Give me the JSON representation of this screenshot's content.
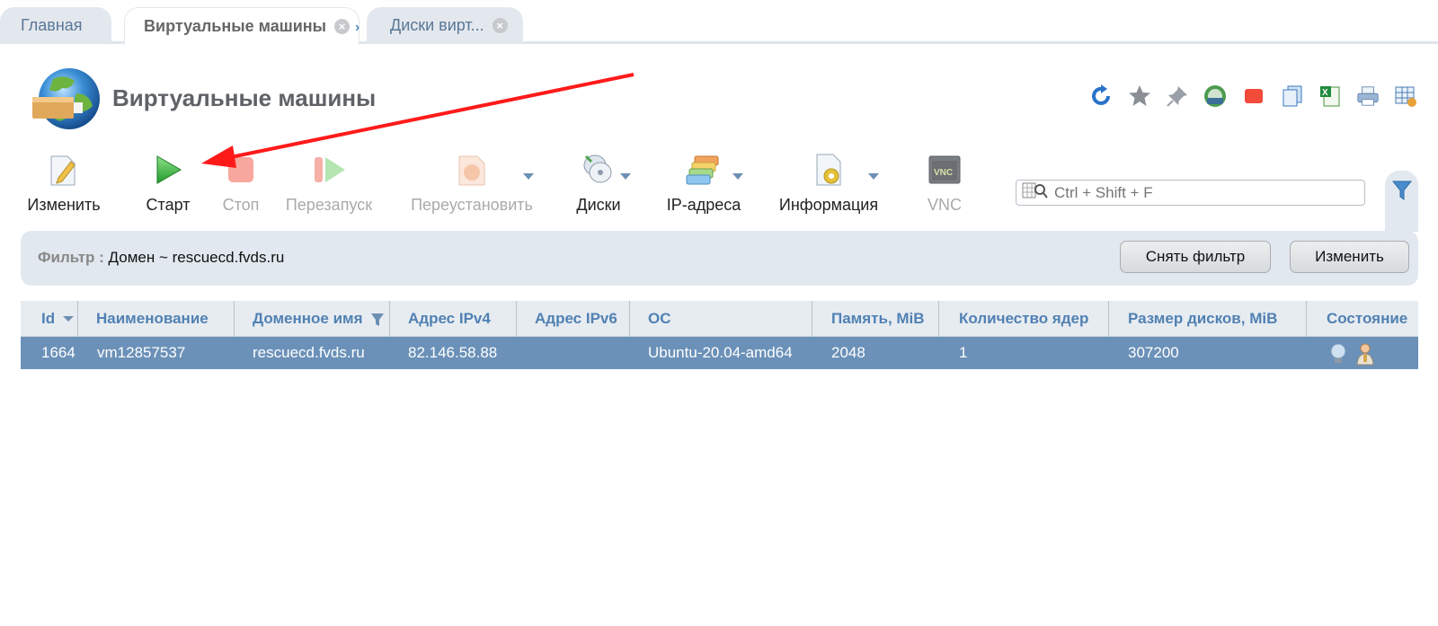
{
  "tabs": [
    {
      "label": "Главная"
    },
    {
      "label": "Виртуальные машины"
    },
    {
      "label": "Диски вирт..."
    }
  ],
  "page": {
    "title": "Виртуальные машины"
  },
  "header_icons": [
    "refresh-icon",
    "star-icon",
    "pin-icon",
    "globe-icon",
    "stop-icon",
    "copy-icon",
    "excel-icon",
    "print-icon",
    "settings-table-icon"
  ],
  "toolbar": {
    "edit": "Изменить",
    "start": "Старт",
    "stop": "Стоп",
    "restart": "Перезапуск",
    "reinstall": "Переустановить",
    "disks": "Диски",
    "ip": "IP-адреса",
    "info": "Информация",
    "vnc": "VNC"
  },
  "search": {
    "placeholder": "Ctrl + Shift + F"
  },
  "filter": {
    "key": "Фильтр :",
    "value": "Домен ~ rescuecd.fvds.ru",
    "clear_label": "Снять фильтр",
    "edit_label": "Изменить"
  },
  "table": {
    "columns": [
      "Id",
      "Наименование",
      "Доменное имя",
      "Адрес IPv4",
      "Адрес IPv6",
      "ОС",
      "Память, MiB",
      "Количество ядер",
      "Размер дисков, MiB",
      "Состояние"
    ],
    "rows": [
      {
        "id": "1664",
        "name": "vm12857537",
        "domain": "rescuecd.fvds.ru",
        "ipv4": "82.146.58.88",
        "ipv6": "",
        "os": "Ubuntu-20.04-amd64",
        "memory": "2048",
        "cores": "1",
        "disk": "307200"
      }
    ]
  },
  "colors": {
    "accent": "#5181b3",
    "row_selected": "#6b91b8",
    "arrow": "#ff1a1a"
  }
}
